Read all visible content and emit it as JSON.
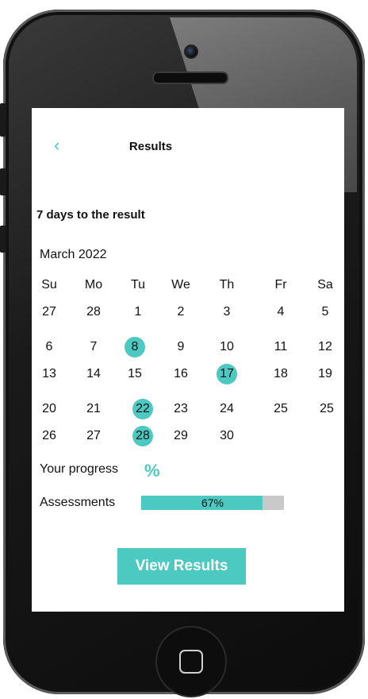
{
  "header": {
    "back_icon": "chevron-left-icon",
    "title": "Results"
  },
  "headline": "7 days to the result",
  "calendar": {
    "month": "March 2022",
    "weekdays": [
      "Su",
      "Mo",
      "Tu",
      "We",
      "Th",
      "Fr",
      "Sa"
    ],
    "rows": [
      [
        "27",
        "28",
        "1",
        "2",
        "3",
        "4",
        "5"
      ],
      [
        "6",
        "7",
        "8",
        "9",
        "10",
        "11",
        "12"
      ],
      [
        "13",
        "14",
        "15",
        "16",
        "17",
        "18",
        "19"
      ],
      [
        "20",
        "21",
        "22",
        "23",
        "24",
        "25",
        "25"
      ],
      [
        "26",
        "27",
        "28",
        "29",
        "30"
      ]
    ],
    "highlighted": [
      "8",
      "17",
      "22",
      "28"
    ]
  },
  "progress": {
    "label": "Your progress",
    "symbol": "%"
  },
  "assessments": {
    "label": "Assessments",
    "percent_text": "67%",
    "fraction": 0.85
  },
  "button": {
    "label": "View Results"
  },
  "colors": {
    "accent": "#4cc9c0",
    "bar_track": "#c9c9c9"
  }
}
